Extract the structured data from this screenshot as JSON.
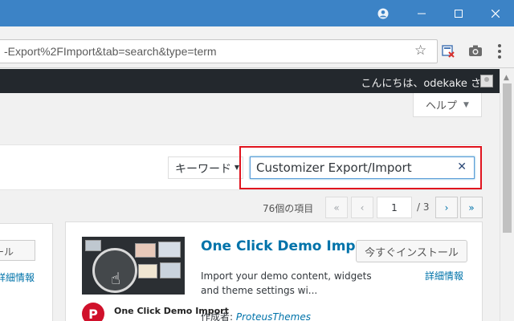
{
  "browser": {
    "url": "-Export%2FImport&tab=search&type=term",
    "icons": [
      "profile-icon",
      "minimize-icon",
      "maximize-icon",
      "close-icon",
      "bookmark-star-icon",
      "extension-icon",
      "camera-icon",
      "menu-icon"
    ]
  },
  "adminbar": {
    "greeting": "こんにちは、odekake さん"
  },
  "help": {
    "label": "ヘルプ"
  },
  "filter": {
    "type_label": "キーワード",
    "search_value": "Customizer Export/Import",
    "highlight_color": "#e0141e"
  },
  "pagination": {
    "items_count": "76個の項目",
    "first": "«",
    "prev": "‹",
    "current_page": "1",
    "total": "/ 3",
    "next": "›",
    "last": "»"
  },
  "left_card": {
    "install_label": "ール",
    "details_label": "詳細情報"
  },
  "plugin": {
    "name": "One Click Demo Import",
    "install_label": "今すぐインストール",
    "description": "Import your demo content, widgets and theme settings wi...",
    "more_details": "詳細情報",
    "author_prefix": "作成者: ",
    "author_name": "ProteusThemes",
    "logo_letter": "P",
    "logo_text": "One Click Demo Import"
  },
  "colors": {
    "titlebar": "#3c83c6",
    "adminbar": "#23282d",
    "link": "#0073aa"
  }
}
